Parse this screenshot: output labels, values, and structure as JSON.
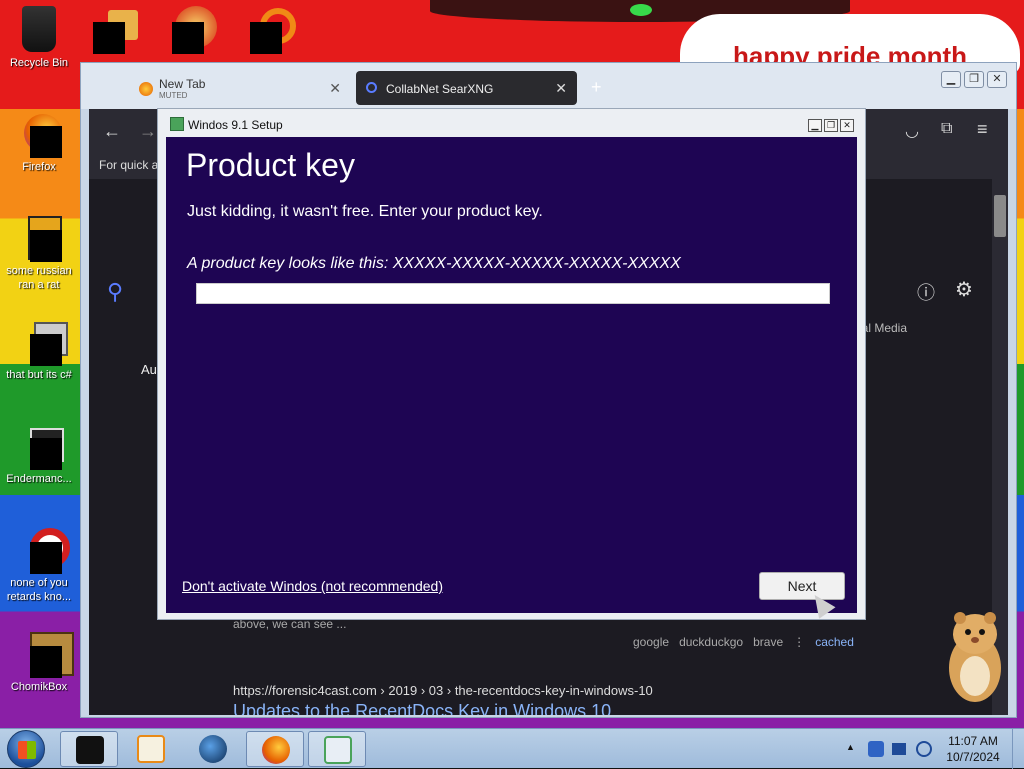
{
  "desktop": {
    "banner_text": "happy pride month",
    "icons": [
      {
        "label": "Recycle Bin"
      },
      {
        "label": "Firefox"
      },
      {
        "label": "some russian ran a rat"
      },
      {
        "label": "that but its c#"
      },
      {
        "label": "Endermanc..."
      },
      {
        "label": "none of you retards kno..."
      },
      {
        "label": "ChomikBox"
      }
    ]
  },
  "browser": {
    "tabs": [
      {
        "title": "New Tab",
        "subtitle": "MUTED"
      },
      {
        "title": "CollabNet SearXNG"
      }
    ],
    "bookmarks_text": "For quick a",
    "partial_text_left": "Au",
    "partial_tab_social": "ial Media",
    "result_snippet": "above, we can see ...",
    "result_links": [
      "google",
      "duckduckgo",
      "brave",
      "cached"
    ],
    "result_url": "https://forensic4cast.com  › 2019 › 03 › the-recentdocs-key-in-windows-10",
    "result_title": "Updates to the RecentDocs Key in Windows 10"
  },
  "setup": {
    "window_title": "Windos 9.1 Setup",
    "heading": "Product key",
    "description": "Just kidding, it wasn't free. Enter your product key.",
    "hint": "A product key looks like this: XXXXX-XXXXX-XXXXX-XXXXX-XXXXX",
    "key_value": "",
    "skip_link": "Don't activate Windos (not recommended)",
    "next_label": "Next"
  },
  "taskbar": {
    "time": "11:07 AM",
    "date": "10/7/2024",
    "tray_overflow": "▲"
  },
  "icons": {
    "back": "arrow-left-icon",
    "forward": "arrow-right-icon",
    "search": "magnifier-icon",
    "info": "info-icon",
    "settings": "gear-icon",
    "pocket": "pocket-icon",
    "extensions": "puzzle-icon",
    "menu": "hamburger-icon"
  },
  "colors": {
    "setup_panel": "#1e0553",
    "browser_dark": "#1c1b22",
    "link_blue": "#8ab4f8"
  }
}
